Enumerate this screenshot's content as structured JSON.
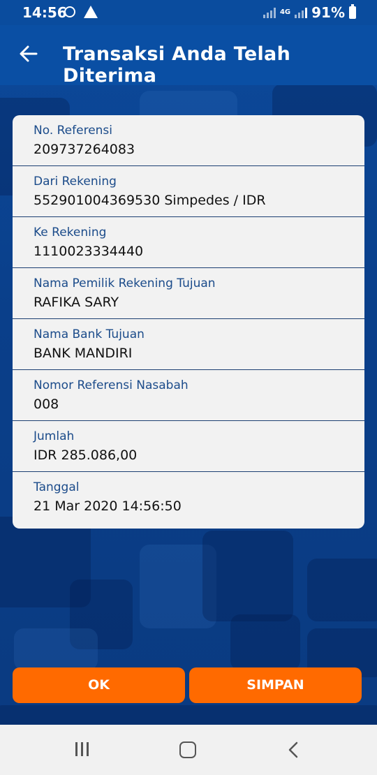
{
  "status_bar": {
    "time": "14:56",
    "network": "4G",
    "battery": "91%"
  },
  "app_bar": {
    "title": "Transaksi Anda Telah Diterima"
  },
  "details": [
    {
      "label": "No. Referensi",
      "value": "209737264083"
    },
    {
      "label": "Dari Rekening",
      "value": "552901004369530  Simpedes / IDR"
    },
    {
      "label": "Ke Rekening",
      "value": "1110023334440"
    },
    {
      "label": "Nama Pemilik Rekening Tujuan",
      "value": "RAFIKA SARY"
    },
    {
      "label": "Nama Bank Tujuan",
      "value": "BANK MANDIRI"
    },
    {
      "label": "Nomor Referensi Nasabah",
      "value": "008"
    },
    {
      "label": "Jumlah",
      "value": "IDR 285.086,00"
    },
    {
      "label": "Tanggal",
      "value": "21 Mar 2020 14:56:50"
    }
  ],
  "buttons": {
    "ok": "OK",
    "simpan": "SIMPAN"
  },
  "colors": {
    "primary": "#0a4fa4",
    "accent": "#ff6a00",
    "label": "#1b4b8a"
  }
}
